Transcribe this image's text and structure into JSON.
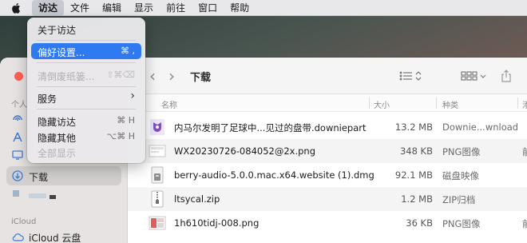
{
  "menubar": {
    "items": [
      "访达",
      "文件",
      "编辑",
      "显示",
      "前往",
      "窗口",
      "帮助"
    ]
  },
  "finder_menu": {
    "about": "关于访达",
    "preferences": {
      "label": "偏好设置...",
      "shortcut": "⌘ ,"
    },
    "empty_trash": {
      "label": "清倒废纸篓...",
      "shortcut": "⇧⌘⌫"
    },
    "services": {
      "label": "服务",
      "arrow": "›"
    },
    "hide_finder": {
      "label": "隐藏访达",
      "shortcut": "⌘ H"
    },
    "hide_others": {
      "label": "隐藏其他",
      "shortcut": "⌥⌘ H"
    },
    "show_all": "全部显示"
  },
  "sidebar": {
    "section_favorites_partial": "个人",
    "downloads": "下载",
    "section_icloud": "iCloud",
    "icloud_drive": "iCloud 云盘"
  },
  "toolbar": {
    "title": "下载",
    "back": "‹",
    "forward": "›"
  },
  "columns": {
    "name": "名称",
    "size": "大小",
    "kind": "种类",
    "date_partial": "添"
  },
  "files": [
    {
      "name": "内马尔发明了足球中...见过的盘带.downiepart",
      "size": "13.2 MB",
      "kind": "Downie...wnload",
      "date": "",
      "icon": "downie-icon"
    },
    {
      "name": "WX20230726-084052@2x.png",
      "size": "348 KB",
      "kind": "PNG图像",
      "date": "前",
      "icon": "png-thumbnail-icon"
    },
    {
      "name": "berry-audio-5.0.0.mac.x64.website (1).dmg",
      "size": "92.1 MB",
      "kind": "磁盘映像",
      "date": "",
      "icon": "dmg-icon"
    },
    {
      "name": "ltsycal.zip",
      "size": "1.2 MB",
      "kind": "ZIP归档",
      "date": "",
      "icon": "zip-icon"
    },
    {
      "name": "1h610tidj-008.png",
      "size": "36 KB",
      "kind": "PNG图像",
      "date": "前",
      "icon": "png-thumbnail-icon"
    }
  ],
  "colors": {
    "menu_highlight": "#2f7af0",
    "traffic_close": "#ff5f57"
  }
}
